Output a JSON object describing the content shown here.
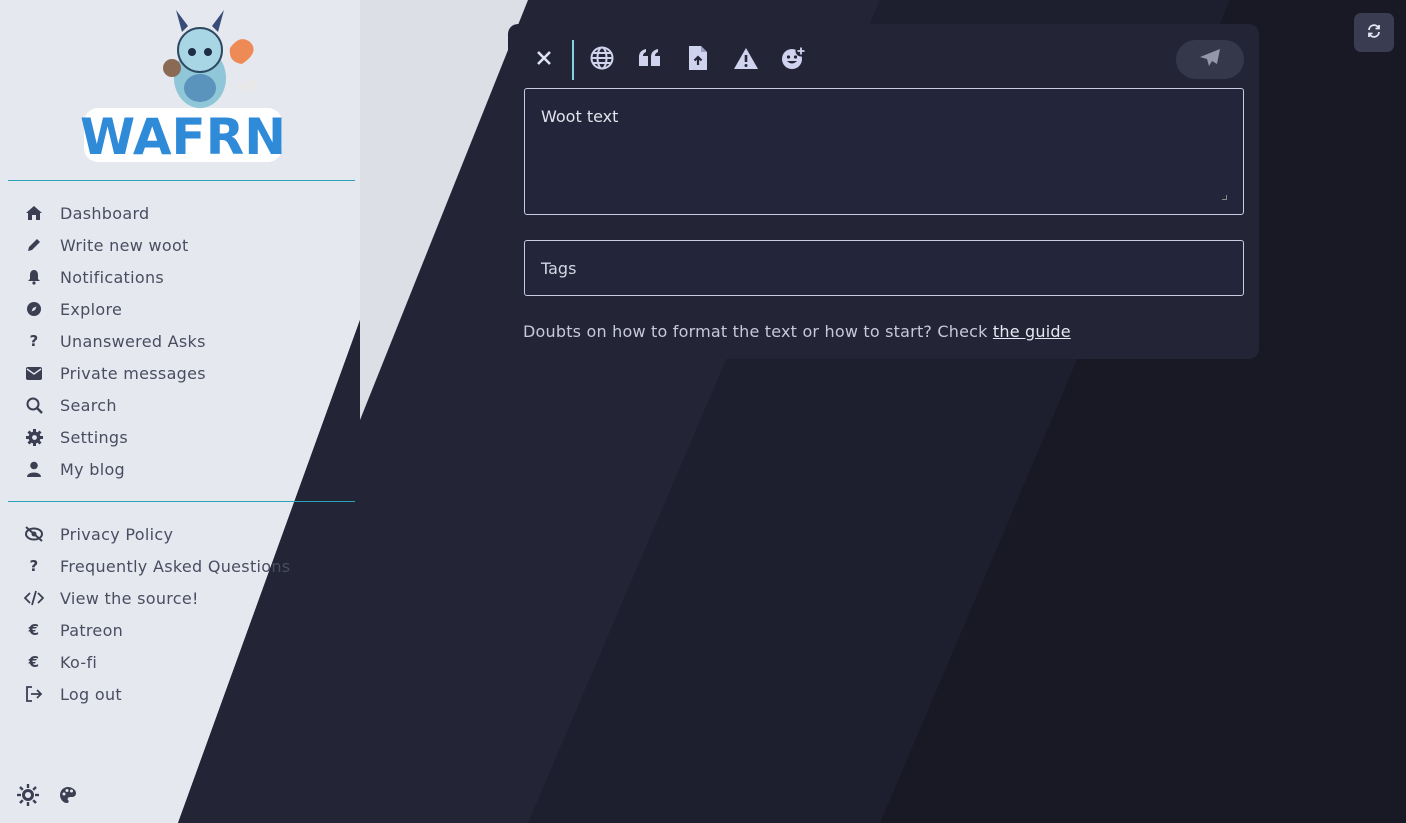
{
  "app": {
    "brand": "WAFRN"
  },
  "sidebar": {
    "nav": [
      {
        "label": "Dashboard",
        "icon": "home-icon"
      },
      {
        "label": "Write new woot",
        "icon": "pencil-icon"
      },
      {
        "label": "Notifications",
        "icon": "bell-icon"
      },
      {
        "label": "Explore",
        "icon": "compass-icon"
      },
      {
        "label": "Unanswered Asks",
        "icon": "question-icon"
      },
      {
        "label": "Private messages",
        "icon": "envelope-icon"
      },
      {
        "label": "Search",
        "icon": "search-icon"
      },
      {
        "label": "Settings",
        "icon": "gear-icon"
      },
      {
        "label": "My blog",
        "icon": "user-icon"
      }
    ],
    "secondary": [
      {
        "label": "Privacy Policy",
        "icon": "eye-slash-icon"
      },
      {
        "label": "Frequently Asked Questions",
        "icon": "question-icon"
      },
      {
        "label": "View the source!",
        "icon": "code-icon"
      },
      {
        "label": "Patreon",
        "icon": "euro-icon"
      },
      {
        "label": "Ko-fi",
        "icon": "euro-icon"
      },
      {
        "label": "Log out",
        "icon": "logout-icon"
      }
    ],
    "bottom_icons": [
      "sun-icon",
      "palette-icon"
    ]
  },
  "editor": {
    "toolbar_icons": [
      "close-icon",
      "globe-icon",
      "quote-icon",
      "file-upload-icon",
      "warning-icon",
      "emoji-add-icon"
    ],
    "woot_placeholder": "Woot text",
    "tags_placeholder": "Tags",
    "help_text": "Doubts on how to format the text or how to start? Check ",
    "help_link": "the guide",
    "send_icon": "paper-plane-icon"
  },
  "colors": {
    "accent": "#2ba2b8",
    "card": "#232536",
    "sidebar_light": "#e6e8f0"
  }
}
